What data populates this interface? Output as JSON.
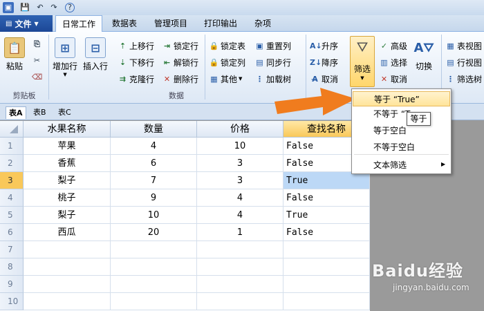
{
  "file_menu": {
    "label": "文件"
  },
  "ribbon_tabs": [
    "日常工作",
    "数据表",
    "管理项目",
    "打印输出",
    "杂项"
  ],
  "clipboard": {
    "paste": "粘贴",
    "group_label": "剪贴板"
  },
  "data_group": {
    "add_row": "增加行",
    "insert_row": "插入行",
    "move_up": "上移行",
    "move_down": "下移行",
    "clone_row": "克隆行",
    "lock_row": "锁定行",
    "unlock_row": "解锁行",
    "delete_row": "删除行",
    "lock_table": "锁定表",
    "lock_column": "锁定列",
    "other": "其他",
    "rearrange_columns": "重置列",
    "sync_rows": "同步行",
    "load_tree": "加载树",
    "group_label": "数据"
  },
  "sort": {
    "asc": "升序",
    "desc": "降序",
    "cancel": "取消"
  },
  "filter": {
    "label": "筛选",
    "advanced": "高级",
    "select": "选择",
    "cancel": "取消",
    "switch": "切换"
  },
  "views": {
    "table_view": "表视图",
    "row_view": "行视图",
    "filter_tree": "筛选树"
  },
  "sheet_tabs": [
    "表A",
    "表B",
    "表C"
  ],
  "table": {
    "columns": [
      "水果名称",
      "数量",
      "价格",
      "查找名称"
    ],
    "rows": [
      [
        "苹果",
        "4",
        "10",
        "False"
      ],
      [
        "香蕉",
        "6",
        "3",
        "False"
      ],
      [
        "梨子",
        "7",
        "3",
        "True"
      ],
      [
        "桃子",
        "9",
        "4",
        "False"
      ],
      [
        "梨子",
        "10",
        "4",
        "True"
      ],
      [
        "西瓜",
        "20",
        "1",
        "False"
      ]
    ],
    "row_numbers": [
      "1",
      "2",
      "3",
      "4",
      "5",
      "6",
      "7",
      "8",
      "9",
      "10"
    ]
  },
  "dropdown": {
    "items": [
      "等于 “True”",
      "不等于 “T",
      "等于空白",
      "不等于空白",
      "文本筛选"
    ]
  },
  "tooltip": "等于",
  "watermark": {
    "brand": "Baidu经验",
    "url": "jingyan.baidu.com"
  },
  "colors": {
    "accent": "#f07c1e",
    "selection": "#bcd8f6",
    "header_selected": "#f9c85a"
  }
}
